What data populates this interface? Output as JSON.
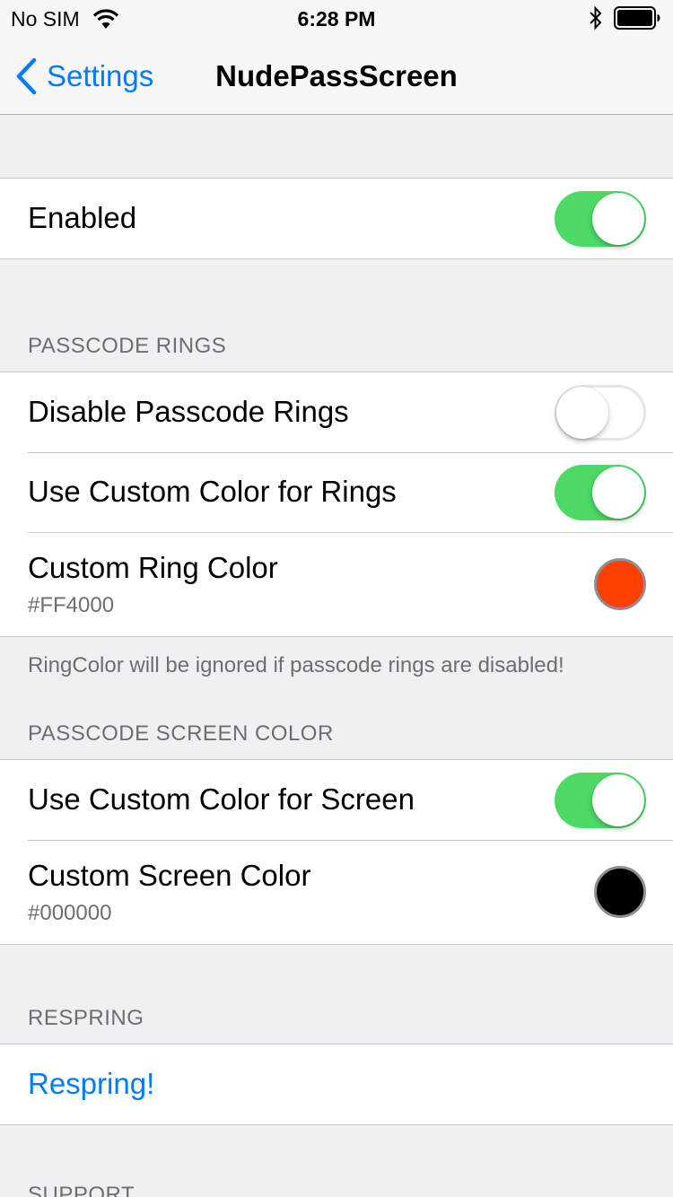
{
  "status_bar": {
    "carrier": "No SIM",
    "time": "6:28 PM",
    "icons": [
      "wifi-icon",
      "bluetooth-icon",
      "battery-icon"
    ]
  },
  "nav": {
    "back_label": "Settings",
    "title": "NudePassScreen"
  },
  "enabled": {
    "label": "Enabled",
    "on": true
  },
  "rings": {
    "header": "PASSCODE RINGS",
    "disable_label": "Disable Passcode Rings",
    "disable_on": false,
    "custom_color_label": "Use Custom Color for Rings",
    "custom_color_on": true,
    "ring_color_label": "Custom Ring Color",
    "ring_color_value": "#FF4000",
    "footer": "RingColor will be ignored if passcode rings are disabled!"
  },
  "screen": {
    "header": "PASSCODE SCREEN COLOR",
    "custom_color_label": "Use Custom Color for Screen",
    "custom_color_on": true,
    "screen_color_label": "Custom Screen Color",
    "screen_color_value": "#000000"
  },
  "respring": {
    "header": "RESPRING",
    "button_label": "Respring!"
  },
  "support": {
    "header": "SUPPORT"
  },
  "colors": {
    "accent": "#007aff",
    "toggle_on": "#4cd964",
    "background": "#efeff4"
  }
}
